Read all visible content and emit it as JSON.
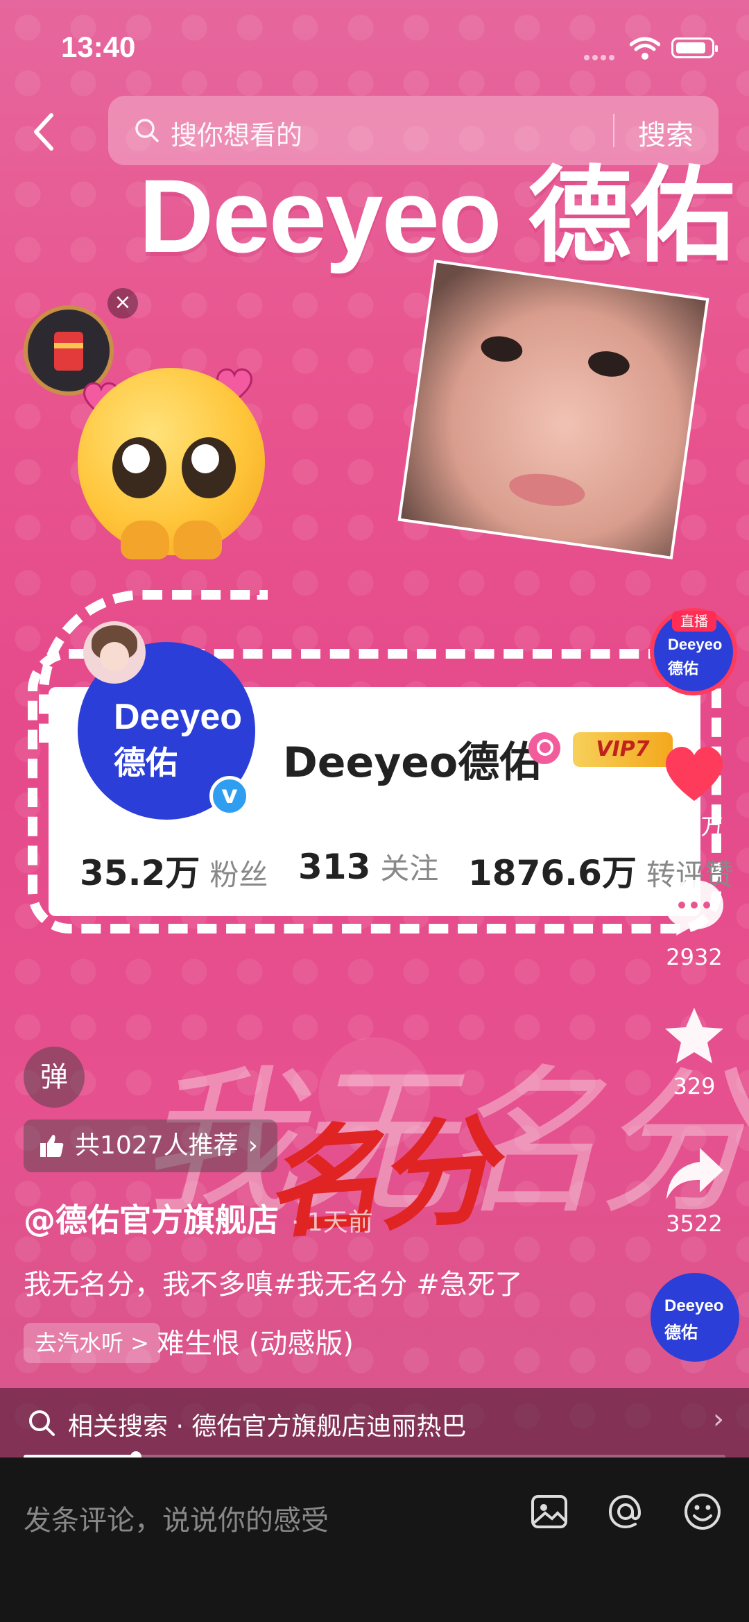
{
  "status": {
    "time": "13:40"
  },
  "search": {
    "placeholder": "搜你想看的",
    "button": "搜索"
  },
  "video": {
    "title_overlay": "Deeyeo 德佑",
    "profile_card": {
      "avatar_line1": "Deeyeo",
      "avatar_line2": "德佑",
      "name": "Deeyeo德佑",
      "vip": "VIP7",
      "stats": [
        {
          "number": "35.2万",
          "label": "粉丝"
        },
        {
          "number": "313",
          "label": "关注"
        },
        {
          "number": "1876.6万",
          "label": "转评赞"
        }
      ]
    },
    "calligraphy": {
      "bg": "我无名分",
      "fg": "名分"
    }
  },
  "danmaku_label": "弹",
  "recommend": {
    "label": "共1027人推荐"
  },
  "post": {
    "author": "@德佑官方旗舰店",
    "time_ago": "· 1天前",
    "description": "我无名分，我不多嗔#我无名分 #急死了",
    "music_tag": "去汽水听 >",
    "music_name": "难生恨 (动感版)"
  },
  "rail": {
    "live_tag": "直播",
    "live_line1": "Deeyeo",
    "live_line2": "德佑",
    "likes": "2.0万",
    "comments": "2932",
    "favorites": "329",
    "shares": "3522",
    "disc_line1": "Deeyeo",
    "disc_line2": "德佑"
  },
  "related": {
    "text": "相关搜索 · 德佑官方旗舰店迪丽热巴"
  },
  "progress": {
    "fraction": 0.16
  },
  "comment": {
    "placeholder": "发条评论，说说你的感受"
  },
  "colors": {
    "accent_like": "#ff3b5c",
    "brand_blue": "#2b3fd8",
    "bg_pink": "#e8558f"
  }
}
